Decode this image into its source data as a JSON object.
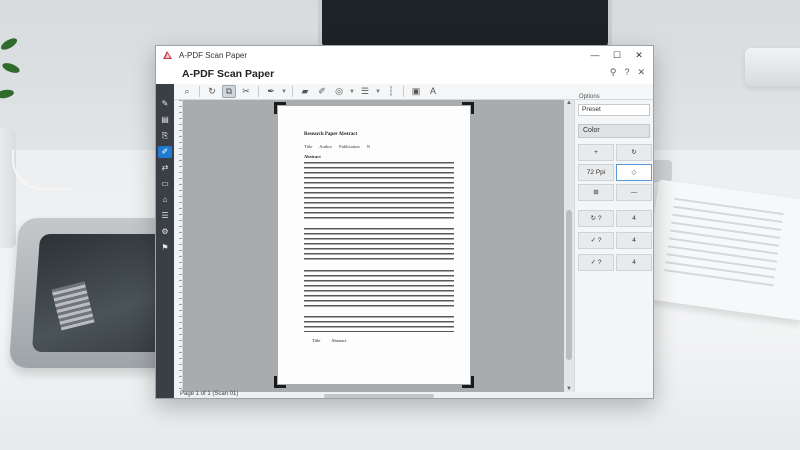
{
  "app": {
    "window_title": "A-PDF Scan Paper",
    "document_title": "A-PDF Scan Paper",
    "header_icons": [
      "pin-icon",
      "help-icon",
      "close-icon"
    ],
    "window_controls": {
      "minimize": "—",
      "maximize": "☐",
      "close": "✕"
    },
    "accent_color": "#1e7bd4"
  },
  "toolbar": {
    "items": [
      "zoom-icon",
      "rotate-icon",
      "crop-icon",
      "cut-icon",
      "pen-icon",
      "highlight-icon",
      "stamp-icon",
      "view-icon",
      "align-icon",
      "measure-icon",
      "image-icon",
      "text-icon"
    ]
  },
  "rail": {
    "items": [
      "select-icon",
      "pages-icon",
      "edit-icon",
      "annotate-icon",
      "convert-icon",
      "scan-icon",
      "protect-icon",
      "form-icon",
      "tools-icon",
      "settings-icon"
    ]
  },
  "document": {
    "title": "Research Paper Abstract",
    "meta": "Title   Author   Publication N",
    "section": "Abstract",
    "footer": "Title   Abstract"
  },
  "status": {
    "text": "Page 1 of 1 (Scan 01)"
  },
  "panel": {
    "heading": "Options",
    "dropdown": "Preset",
    "button": "Color",
    "rows": [
      {
        "left": "+",
        "right": "↻"
      },
      {
        "left": "72 Ppi",
        "right": "◇"
      },
      {
        "left": "⊞",
        "right": "—"
      },
      {
        "left": "↻ ?",
        "right": "4"
      },
      {
        "left": "✓ ?",
        "right": "4"
      },
      {
        "left": "✓ ?",
        "right": "4"
      }
    ]
  }
}
